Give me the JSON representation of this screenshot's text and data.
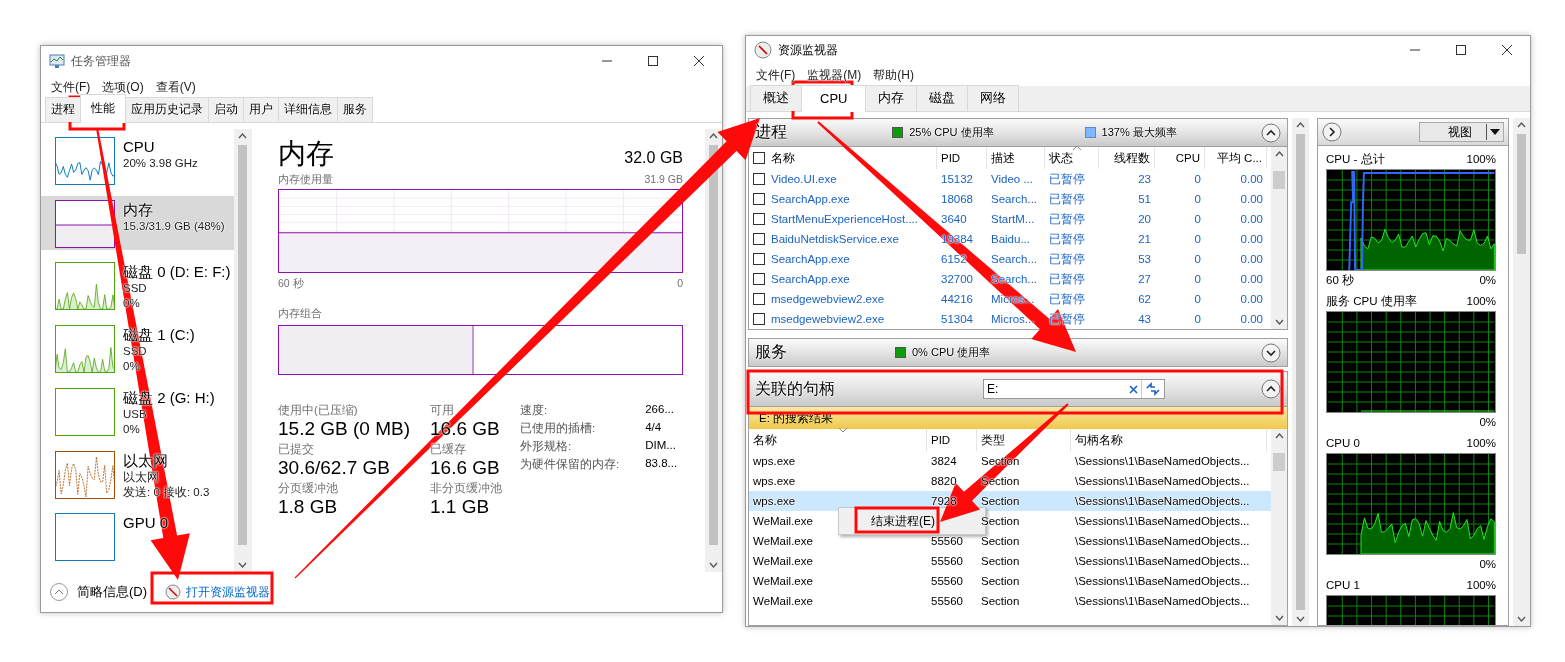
{
  "task_manager": {
    "title": "任务管理器",
    "menu": [
      "文件(F)",
      "选项(O)",
      "查看(V)"
    ],
    "tabs": [
      {
        "label": "进程",
        "selected": false
      },
      {
        "label": "性能",
        "selected": true
      },
      {
        "label": "应用历史记录",
        "selected": false
      },
      {
        "label": "启动",
        "selected": false
      },
      {
        "label": "用户",
        "selected": false
      },
      {
        "label": "详细信息",
        "selected": false
      },
      {
        "label": "服务",
        "selected": false
      }
    ],
    "devices": [
      {
        "kind": "cpu",
        "title": "CPU",
        "lines": [
          "20% 3.98 GHz"
        ],
        "color": "#117dbb",
        "selected": false
      },
      {
        "kind": "memory",
        "title": "内存",
        "lines": [
          "15.3/31.9 GB (48%)"
        ],
        "color": "#8b12ae",
        "selected": true
      },
      {
        "kind": "disk",
        "title": "磁盘 0 (D: E: F:)",
        "lines": [
          "SSD",
          "0%"
        ],
        "color": "#4da60c",
        "selected": false
      },
      {
        "kind": "disk",
        "title": "磁盘 1 (C:)",
        "lines": [
          "SSD",
          "0%"
        ],
        "color": "#4da60c",
        "selected": false
      },
      {
        "kind": "idle",
        "title": "磁盘 2 (G: H:)",
        "lines": [
          "USB",
          "0%"
        ],
        "color": "#4da60c",
        "selected": false
      },
      {
        "kind": "network",
        "title": "以太网",
        "lines": [
          "以太网",
          "发送: 0 接收: 0.3"
        ],
        "color": "#a74f01",
        "selected": false
      },
      {
        "kind": "idle",
        "title": "GPU 0",
        "color": "#117dbb",
        "selected": false
      }
    ],
    "detail": {
      "title": "内存",
      "total": "32.0 GB",
      "usage": {
        "label": "内存使用量",
        "max": "31.9 GB",
        "time": "60 秒",
        "zero": "0"
      },
      "composition": {
        "label": "内存组合",
        "level": 0.48
      },
      "stats": [
        {
          "label": "使用中(已压缩)",
          "value": "15.2 GB (0 MB)"
        },
        {
          "label": "可用",
          "value": "16.6 GB"
        },
        {
          "label": "已提交",
          "value": "30.6/62.7 GB"
        },
        {
          "label": "已缓存",
          "value": "16.6 GB"
        },
        {
          "label": "分页缓冲池",
          "value": "1.8 GB"
        },
        {
          "label": "非分页缓冲池",
          "value": "1.1 GB"
        }
      ],
      "specs": [
        {
          "label": "速度:",
          "value": "266..."
        },
        {
          "label": "已使用的插槽:",
          "value": "4/4"
        },
        {
          "label": "外形规格:",
          "value": "DIM..."
        },
        {
          "label": "为硬件保留的内存:",
          "value": "83.8..."
        }
      ]
    },
    "footer": {
      "collapse_label": "简略信息(D)",
      "link": "打开资源监视器"
    }
  },
  "resource_monitor": {
    "title": "资源监视器",
    "menu": [
      "文件(F)",
      "监视器(M)",
      "帮助(H)"
    ],
    "tabs": [
      {
        "label": "概述",
        "selected": false
      },
      {
        "label": "CPU",
        "selected": true
      },
      {
        "label": "内存",
        "selected": false
      },
      {
        "label": "磁盘",
        "selected": false
      },
      {
        "label": "网络",
        "selected": false
      }
    ],
    "processes": {
      "title": "进程",
      "expanded": true,
      "cpu_usage": "25% CPU 使用率",
      "max_frequency": "137% 最大频率",
      "all_checked": false,
      "columns": [
        {
          "label": "名称",
          "sorted": false
        },
        {
          "label": "PID",
          "sorted": false
        },
        {
          "label": "描述",
          "sorted": false
        },
        {
          "label": "状态",
          "sorted": true
        },
        {
          "label": "线程数",
          "sorted": false
        },
        {
          "label": "CPU",
          "sorted": false
        },
        {
          "label": "平均 C...",
          "sorted": false
        }
      ],
      "rows": [
        {
          "name": "Video.UI.exe",
          "pid": "15132",
          "description": "Video ...",
          "status": "已暂停",
          "threads": "23",
          "cpu": "0",
          "avg_cpu": "0.00",
          "checked": false,
          "suspended": true
        },
        {
          "name": "SearchApp.exe",
          "pid": "18068",
          "description": "Search...",
          "status": "已暂停",
          "threads": "51",
          "cpu": "0",
          "avg_cpu": "0.00",
          "checked": false,
          "suspended": true
        },
        {
          "name": "StartMenuExperienceHost....",
          "pid": "3640",
          "description": "StartM...",
          "status": "已暂停",
          "threads": "20",
          "cpu": "0",
          "avg_cpu": "0.00",
          "checked": false,
          "suspended": true
        },
        {
          "name": "BaiduNetdiskService.exe",
          "pid": "19384",
          "description": "Baidu...",
          "status": "已暂停",
          "threads": "21",
          "cpu": "0",
          "avg_cpu": "0.00",
          "checked": false,
          "suspended": true
        },
        {
          "name": "SearchApp.exe",
          "pid": "6152",
          "description": "Search...",
          "status": "已暂停",
          "threads": "53",
          "cpu": "0",
          "avg_cpu": "0.00",
          "checked": false,
          "suspended": true
        },
        {
          "name": "SearchApp.exe",
          "pid": "32700",
          "description": "Search...",
          "status": "已暂停",
          "threads": "27",
          "cpu": "0",
          "avg_cpu": "0.00",
          "checked": false,
          "suspended": true
        },
        {
          "name": "msedgewebview2.exe",
          "pid": "44216",
          "description": "Micros...",
          "status": "已暂停",
          "threads": "62",
          "cpu": "0",
          "avg_cpu": "0.00",
          "checked": false,
          "suspended": true
        },
        {
          "name": "msedgewebview2.exe",
          "pid": "51304",
          "description": "Micros...",
          "status": "已暂停",
          "threads": "43",
          "cpu": "0",
          "avg_cpu": "0.00",
          "checked": false,
          "suspended": true
        }
      ]
    },
    "services": {
      "title": "服务",
      "expanded": false,
      "cpu_usage": "0% CPU 使用率"
    },
    "handles": {
      "title": "关联的句柄",
      "expanded": true,
      "search": {
        "value": "E:"
      },
      "result_banner": "E: 的搜索结果",
      "columns": [
        {
          "label": "名称",
          "sorted": true
        },
        {
          "label": "PID",
          "sorted": false
        },
        {
          "label": "类型",
          "sorted": false
        },
        {
          "label": "句柄名称",
          "sorted": false
        }
      ],
      "rows": [
        {
          "name": "wps.exe",
          "pid": "3824",
          "type": "Section",
          "handle": "\\Sessions\\1\\BaseNamedObjects...",
          "selected": false
        },
        {
          "name": "wps.exe",
          "pid": "8820",
          "type": "Section",
          "handle": "\\Sessions\\1\\BaseNamedObjects...",
          "selected": false
        },
        {
          "name": "wps.exe",
          "pid": "7928",
          "type": "Section",
          "handle": "\\Sessions\\1\\BaseNamedObjects...",
          "selected": true
        },
        {
          "name": "WeMail.exe",
          "type": "Section",
          "handle": "\\Sessions\\1\\BaseNamedObjects...",
          "selected": false
        },
        {
          "name": "WeMail.exe",
          "pid": "55560",
          "type": "Section",
          "handle": "\\Sessions\\1\\BaseNamedObjects...",
          "selected": false
        },
        {
          "name": "WeMail.exe",
          "pid": "55560",
          "type": "Section",
          "handle": "\\Sessions\\1\\BaseNamedObjects...",
          "selected": false
        },
        {
          "name": "WeMail.exe",
          "pid": "55560",
          "type": "Section",
          "handle": "\\Sessions\\1\\BaseNamedObjects...",
          "selected": false
        },
        {
          "name": "WeMail.exe",
          "pid": "55560",
          "type": "Section",
          "handle": "\\Sessions\\1\\BaseNamedObjects...",
          "selected": false
        }
      ]
    },
    "context_menu": {
      "items": [
        "结束进程(E)"
      ]
    },
    "graphs_pane": {
      "view_button": "视图",
      "graphs": [
        {
          "kind": "total",
          "title": "CPU - 总计",
          "max": "100%",
          "time": "60 秒",
          "min": "0%"
        },
        {
          "kind": "idle",
          "title": "服务 CPU 使用率",
          "max": "100%",
          "min": "0%"
        },
        {
          "kind": "core",
          "title": "CPU 0",
          "max": "100%",
          "min": "0%"
        },
        {
          "kind": "core",
          "title": "CPU 1",
          "max": "100%"
        }
      ]
    }
  }
}
